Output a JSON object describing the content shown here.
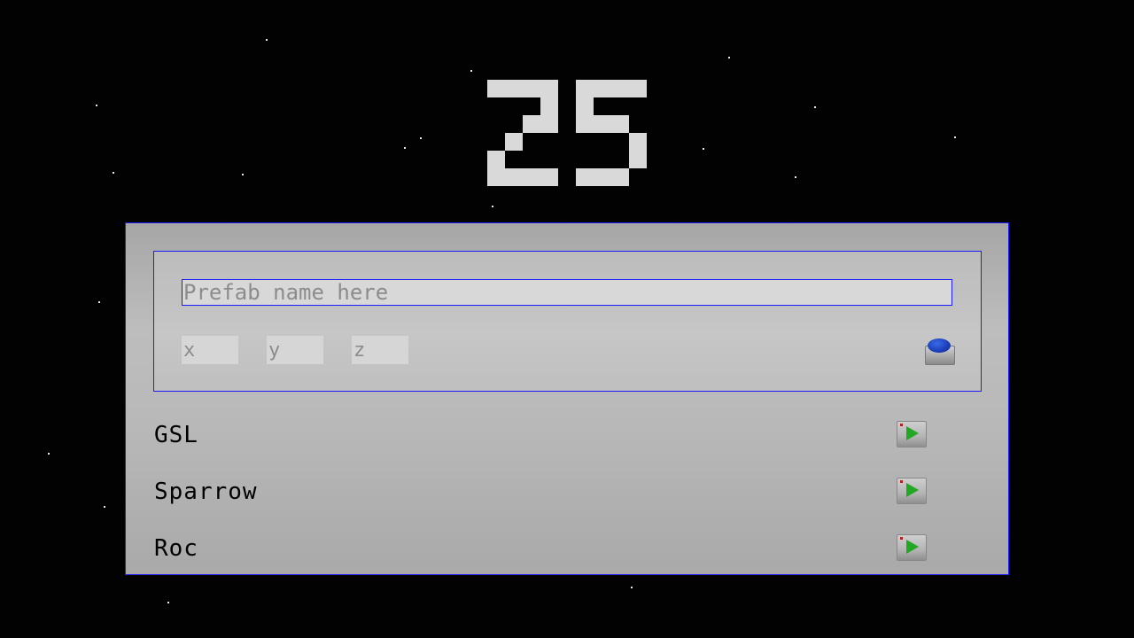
{
  "header": {
    "level_number": "25"
  },
  "spawn_form": {
    "name_placeholder": "Prefab name here",
    "name_value": "",
    "x_placeholder": "x",
    "y_placeholder": "y",
    "z_placeholder": "z"
  },
  "prefabs": [
    {
      "label": "GSL"
    },
    {
      "label": "Sparrow"
    },
    {
      "label": "Roc"
    }
  ],
  "colors": {
    "background": "#020202",
    "panel_border": "#1c1cff",
    "title_digits": "#d9d9d9",
    "play_icon": "#22a822",
    "spawn_knob": "#1a3eb8"
  },
  "icons": {
    "spawn_button": "blue-push-button-icon",
    "row_button": "play-icon"
  }
}
